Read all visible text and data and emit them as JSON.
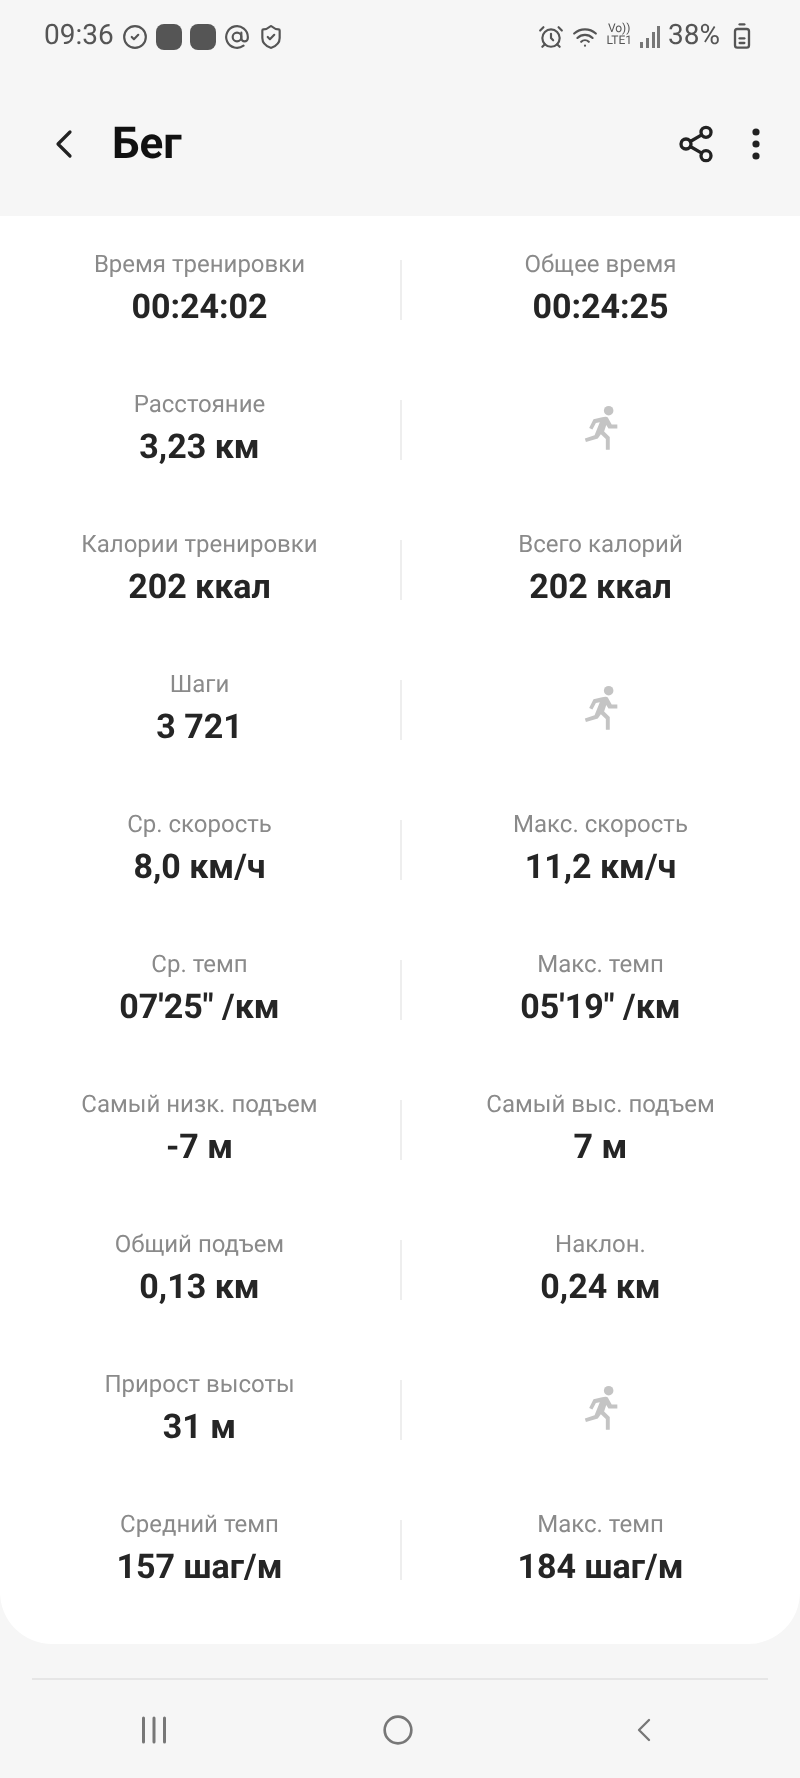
{
  "status_bar": {
    "time": "09:36",
    "volte_top": "Vo))",
    "volte_bottom": "LTE1",
    "battery": "38%"
  },
  "header": {
    "title": "Бег"
  },
  "rows": [
    {
      "left": {
        "kind": "stat",
        "label": "Время тренировки",
        "value": "00:24:02"
      },
      "right": {
        "kind": "stat",
        "label": "Общее время",
        "value": "00:24:25"
      }
    },
    {
      "left": {
        "kind": "stat",
        "label": "Расстояние",
        "value": "3,23 км"
      },
      "right": {
        "kind": "icon"
      }
    },
    {
      "left": {
        "kind": "stat",
        "label": "Калории тренировки",
        "value": "202 ккал"
      },
      "right": {
        "kind": "stat",
        "label": "Всего калорий",
        "value": "202 ккал"
      }
    },
    {
      "left": {
        "kind": "stat",
        "label": "Шаги",
        "value": "3 721"
      },
      "right": {
        "kind": "icon"
      }
    },
    {
      "left": {
        "kind": "stat",
        "label": "Ср. скорость",
        "value": "8,0 км/ч"
      },
      "right": {
        "kind": "stat",
        "label": "Макс. скорость",
        "value": "11,2 км/ч"
      }
    },
    {
      "left": {
        "kind": "stat",
        "label": "Ср. темп",
        "value": "07'25\" /км"
      },
      "right": {
        "kind": "stat",
        "label": "Макс. темп",
        "value": "05'19\" /км"
      }
    },
    {
      "left": {
        "kind": "stat",
        "label": "Самый низк. подъем",
        "value": "-7 м"
      },
      "right": {
        "kind": "stat",
        "label": "Самый выс. подъем",
        "value": "7 м"
      }
    },
    {
      "left": {
        "kind": "stat",
        "label": "Общий подъем",
        "value": "0,13 км"
      },
      "right": {
        "kind": "stat",
        "label": "Наклон.",
        "value": "0,24 км"
      }
    },
    {
      "left": {
        "kind": "stat",
        "label": "Прирост высоты",
        "value": "31 м"
      },
      "right": {
        "kind": "icon"
      }
    },
    {
      "left": {
        "kind": "stat",
        "label": "Средний темп",
        "value": "157 шаг/м"
      },
      "right": {
        "kind": "stat",
        "label": "Макс. темп",
        "value": "184 шаг/м"
      }
    }
  ]
}
